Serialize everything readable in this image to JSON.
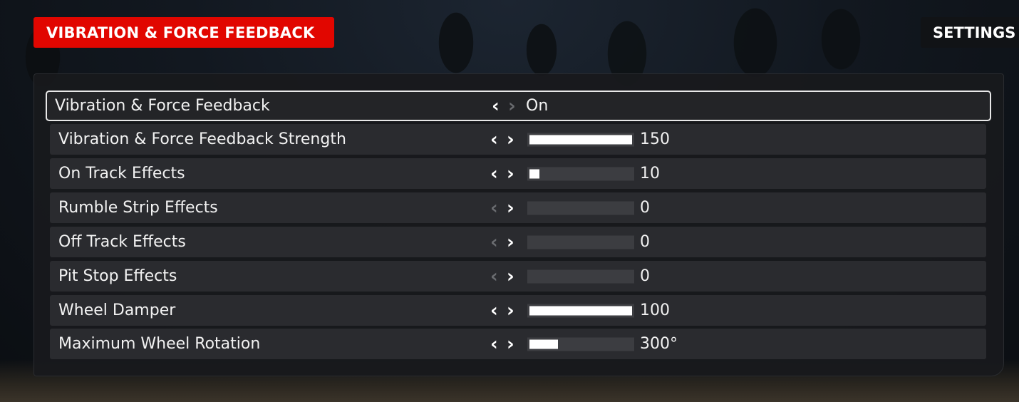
{
  "header": {
    "title": "VIBRATION & FORCE FEEDBACK",
    "settings_tab": "SETTINGS"
  },
  "rows": [
    {
      "label": "Vibration & Force Feedback",
      "type": "toggle",
      "value": "On",
      "selected": true,
      "left_enabled": true,
      "right_enabled": false
    },
    {
      "label": "Vibration & Force Feedback Strength",
      "type": "slider",
      "value": "150",
      "fill_fraction": 1.0,
      "left_enabled": true,
      "right_enabled": true
    },
    {
      "label": "On Track Effects",
      "type": "slider",
      "value": "10",
      "fill_fraction": 0.1,
      "left_enabled": true,
      "right_enabled": true
    },
    {
      "label": "Rumble Strip Effects",
      "type": "slider",
      "value": "0",
      "fill_fraction": 0.0,
      "left_enabled": false,
      "right_enabled": true
    },
    {
      "label": "Off Track Effects",
      "type": "slider",
      "value": "0",
      "fill_fraction": 0.0,
      "left_enabled": false,
      "right_enabled": true
    },
    {
      "label": "Pit Stop Effects",
      "type": "slider",
      "value": "0",
      "fill_fraction": 0.0,
      "left_enabled": false,
      "right_enabled": true
    },
    {
      "label": "Wheel Damper",
      "type": "slider",
      "value": "100",
      "fill_fraction": 1.0,
      "left_enabled": true,
      "right_enabled": true
    },
    {
      "label": "Maximum Wheel Rotation",
      "type": "slider",
      "value": "300°",
      "fill_fraction": 0.28,
      "left_enabled": true,
      "right_enabled": true
    }
  ],
  "icons": {
    "left": "chevron-left-icon",
    "right": "chevron-right-icon"
  },
  "colors": {
    "accent": "#e10600"
  }
}
